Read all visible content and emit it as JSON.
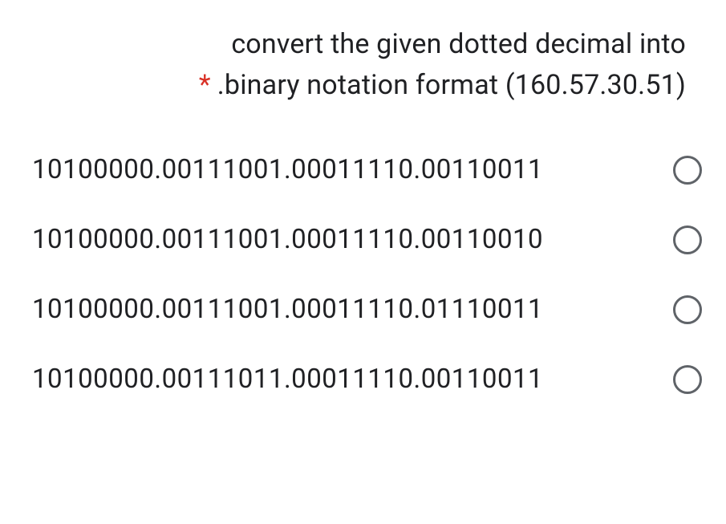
{
  "question": {
    "line1": "convert the given dotted decimal into",
    "line2": ".binary notation format (160.57.30.51)",
    "required_mark": "*"
  },
  "options": [
    {
      "label": "10100000.00111001.00011110.00110011"
    },
    {
      "label": "10100000.00111001.00011110.00110010"
    },
    {
      "label": "10100000.00111001.00011110.01110011"
    },
    {
      "label": "10100000.00111011.00011110.00110011"
    }
  ]
}
